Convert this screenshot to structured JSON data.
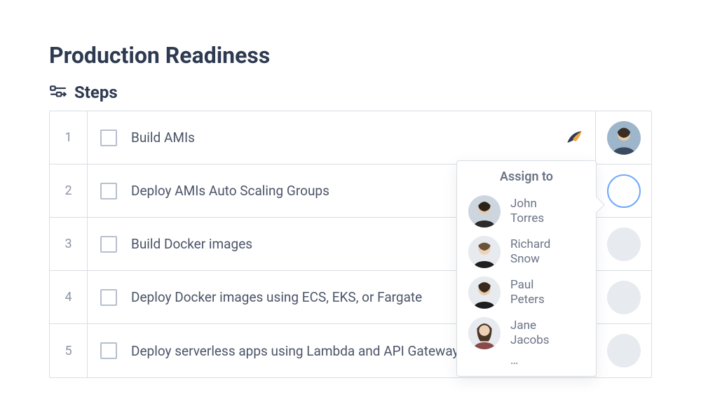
{
  "page_title": "Production Readiness",
  "section_title": "Steps",
  "steps": [
    {
      "num": "1",
      "label": "Build AMIs",
      "has_service_icon": true,
      "assignee": "john"
    },
    {
      "num": "2",
      "label": "Deploy AMIs Auto Scaling Groups",
      "assignee_selected": true
    },
    {
      "num": "3",
      "label": "Build Docker images"
    },
    {
      "num": "4",
      "label": "Deploy Docker images using ECS, EKS, or Fargate"
    },
    {
      "num": "5",
      "label": "Deploy serverless apps using Lambda and API Gateway"
    }
  ],
  "popover": {
    "title": "Assign to",
    "people": [
      {
        "first": "John",
        "last": "Torres"
      },
      {
        "first": "Richard",
        "last": "Snow"
      },
      {
        "first": "Paul",
        "last": "Peters"
      },
      {
        "first": "Jane",
        "last": "Jacobs"
      }
    ],
    "more": "…"
  }
}
